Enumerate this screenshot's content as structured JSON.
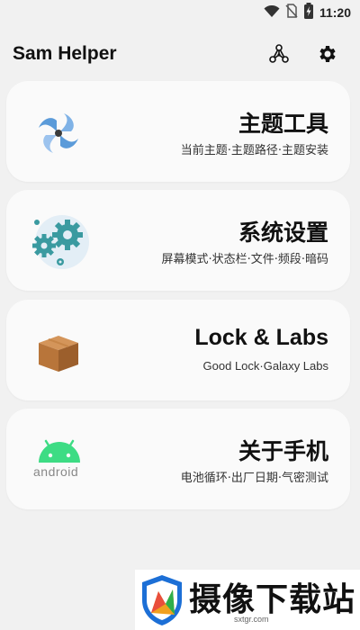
{
  "status_bar": {
    "time": "11:20",
    "icons": [
      "wifi-icon",
      "no-sim-icon",
      "battery-charging-icon"
    ]
  },
  "app_bar": {
    "title": "Sam Helper",
    "actions": [
      "network-nodes-icon",
      "gear-icon"
    ]
  },
  "cards": [
    {
      "title": "主题工具",
      "subtitle": "当前主题·主题路径·主题安装",
      "icon": "pinwheel-icon"
    },
    {
      "title": "系统设置",
      "subtitle": "屏幕模式·状态栏·文件·频段·暗码",
      "icon": "gears-icon"
    },
    {
      "title": "Lock & Labs",
      "subtitle": "Good Lock·Galaxy Labs",
      "icon": "box-icon"
    },
    {
      "title": "关于手机",
      "subtitle": "电池循环·出厂日期·气密测试",
      "icon": "android-icon",
      "icon_text": "android"
    }
  ],
  "watermark": {
    "text": "摄像下载站",
    "url": "sxtgr.com"
  },
  "colors": {
    "background": "#f1f1f1",
    "card": "#fafafa",
    "android_green": "#3ddc84",
    "gear_teal": "#3a9aa0",
    "box_brown": "#b8753a"
  }
}
